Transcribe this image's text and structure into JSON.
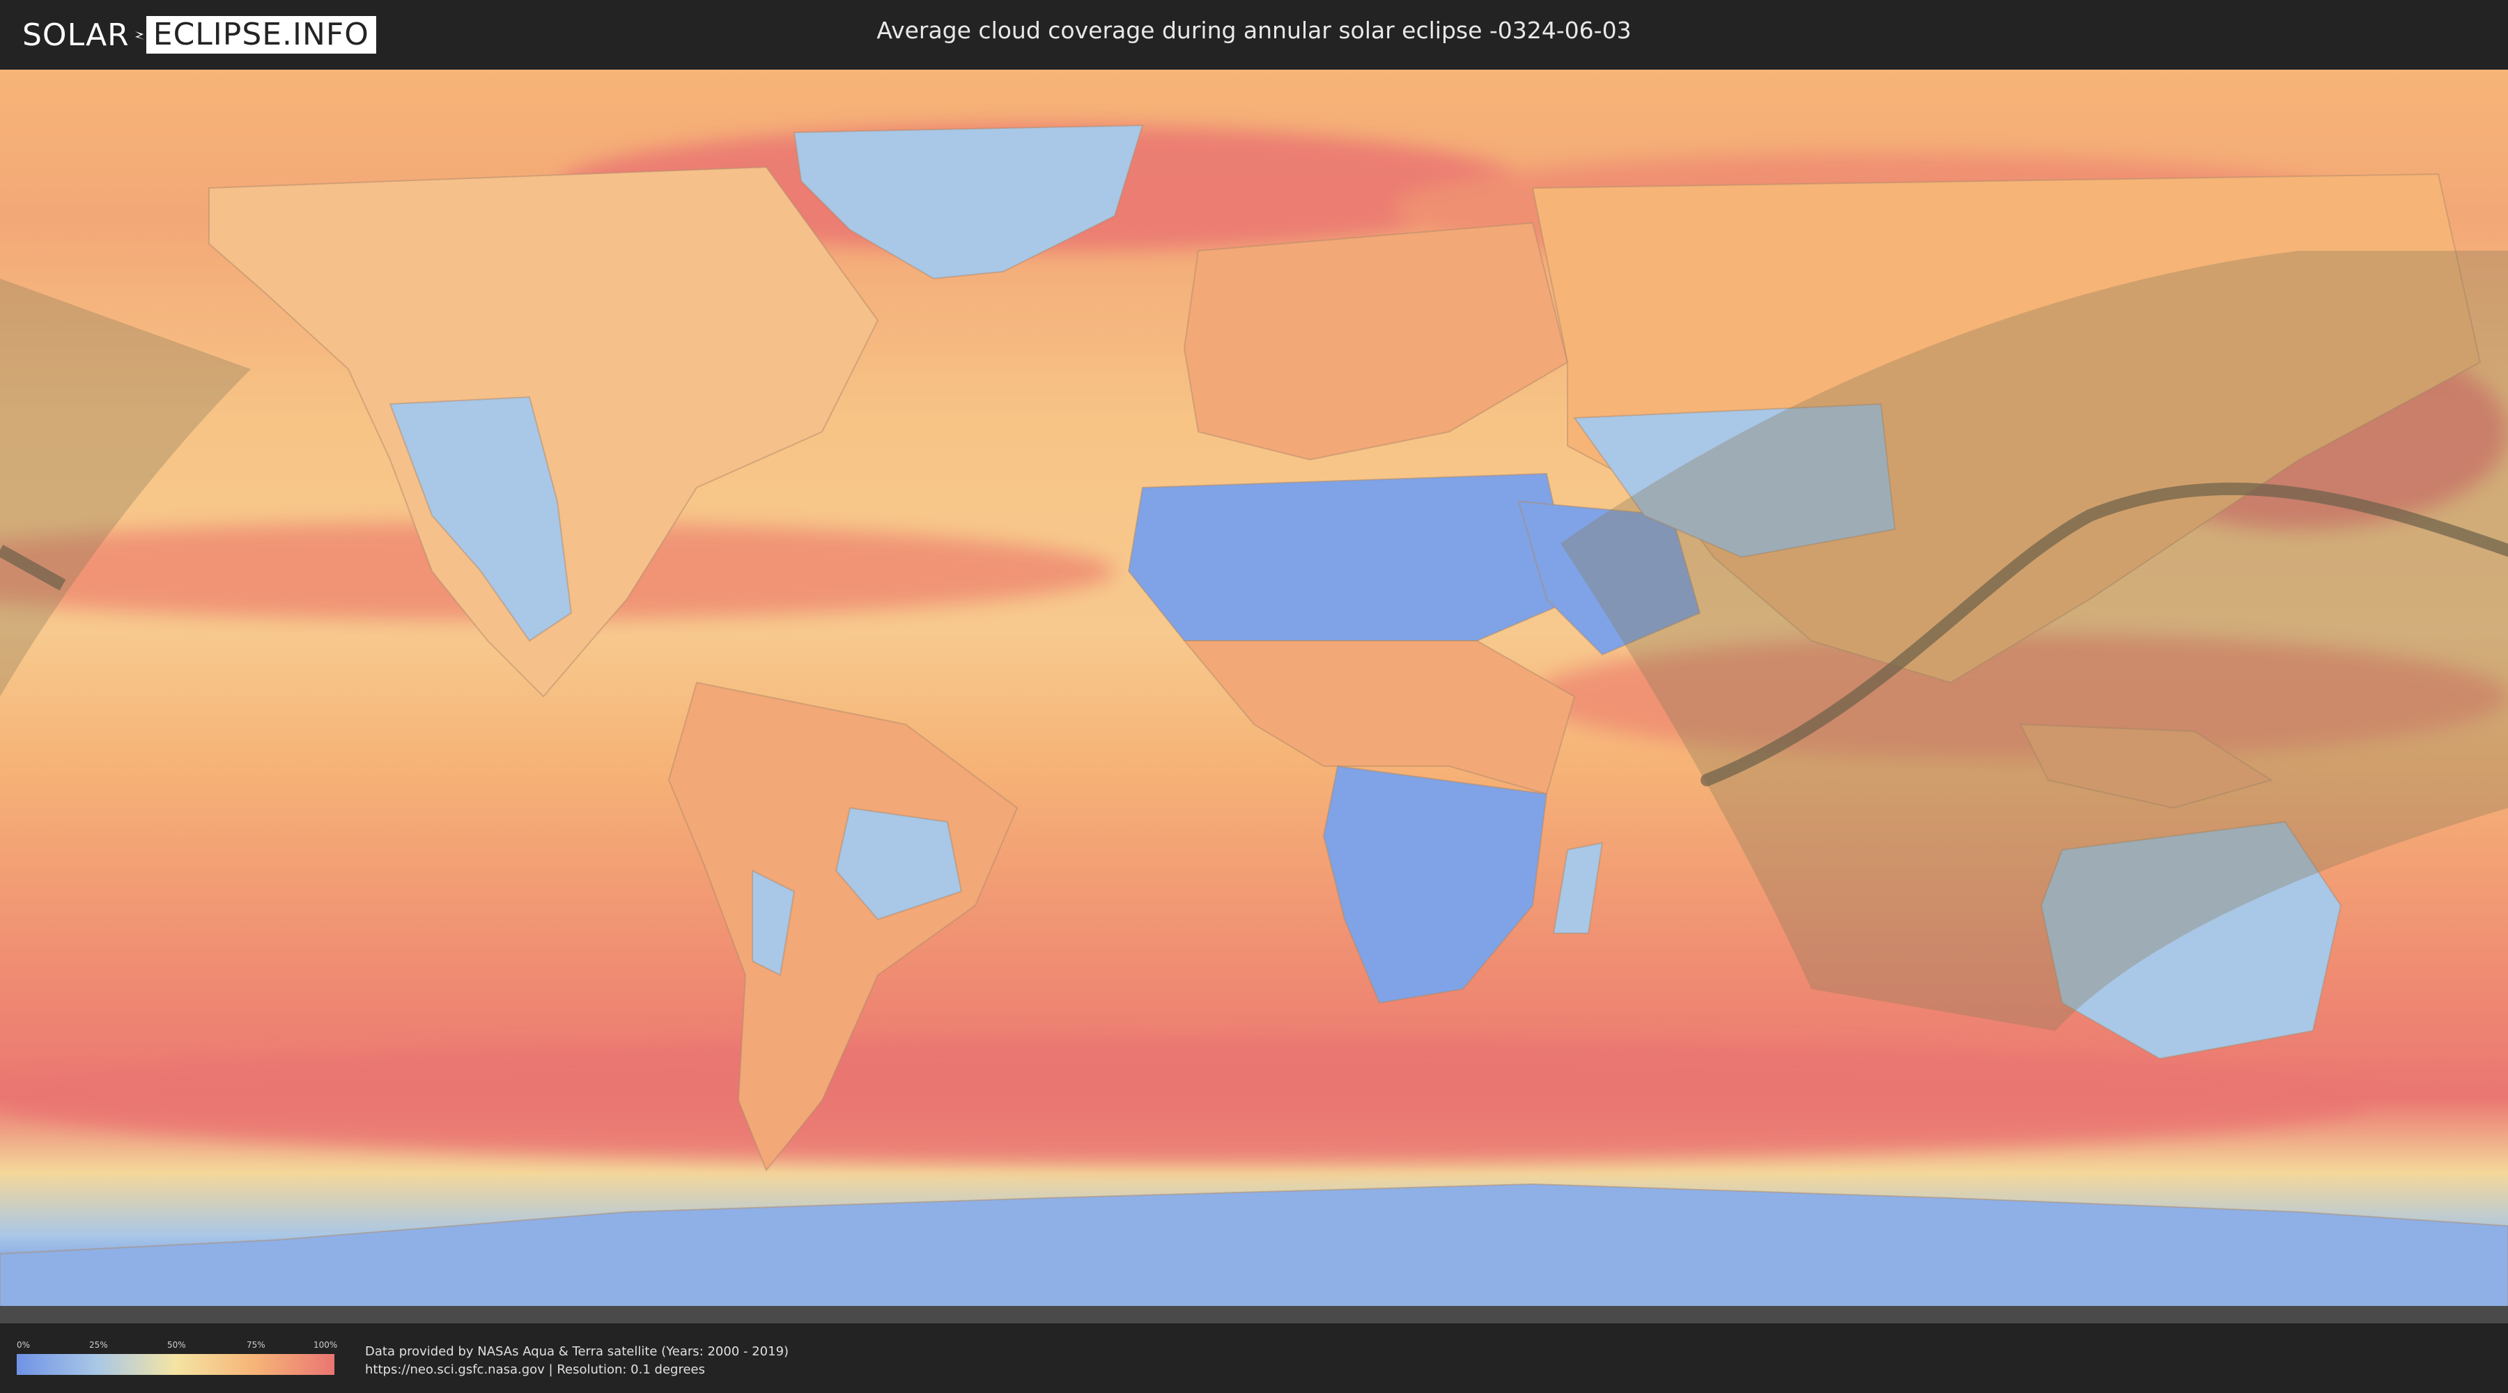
{
  "header": {
    "logo_left": "SOLAR",
    "logo_right": "ECLIPSE.INFO",
    "title": "Average cloud coverage during annular solar eclipse -0324-06-03"
  },
  "legend": {
    "ticks": [
      "0%",
      "25%",
      "50%",
      "75%",
      "100%"
    ],
    "colors": {
      "0": "#6f93e6",
      "25": "#a9c7e6",
      "50": "#f4e4a4",
      "75": "#f6b477",
      "100": "#ea7672"
    }
  },
  "credits": {
    "line1": "Data provided by NASAs Aqua & Terra satellite (Years: 2000 - 2019)",
    "line2": "https://neo.sci.gsfc.nasa.gov | Resolution: 0.1 degrees"
  },
  "map_colors": {
    "cloudy": "#ea7672",
    "moderate": "#f6b477",
    "clear": "#a9c7e6",
    "very_clear": "#6f93e6",
    "visibility_overlay": "#8a7a5a",
    "eclipse_path": "#6b6048"
  },
  "icons": {
    "logo_mark": "eclipse-bolt-icon"
  }
}
